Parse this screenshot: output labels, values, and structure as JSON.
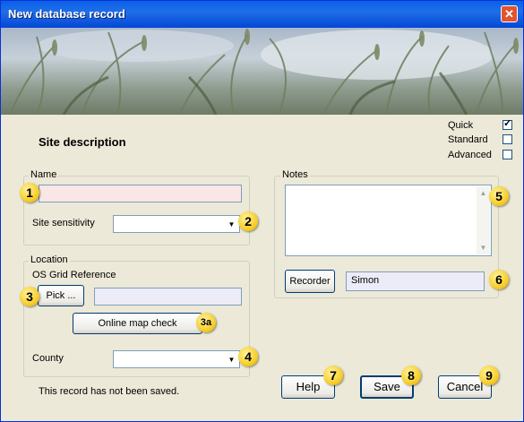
{
  "window": {
    "title": "New database record",
    "close_glyph": "✕"
  },
  "section_title": "Site description",
  "modes": [
    {
      "label": "Quick",
      "checked": true
    },
    {
      "label": "Standard",
      "checked": false
    },
    {
      "label": "Advanced",
      "checked": false
    }
  ],
  "name_group": {
    "legend": "Name",
    "name_value": "",
    "sensitivity_label": "Site sensitivity",
    "sensitivity_value": ""
  },
  "location_group": {
    "legend": "Location",
    "grid_ref_label": "OS Grid Reference",
    "pick_label": "Pick ...",
    "grid_ref_value": "",
    "map_check_label": "Online map check",
    "county_label": "County",
    "county_value": ""
  },
  "notes_group": {
    "legend": "Notes",
    "notes_value": "",
    "recorder_label": "Recorder",
    "recorder_value": "Simon"
  },
  "status_text": "This record has not been saved.",
  "buttons": {
    "help": "Help",
    "save": "Save",
    "cancel": "Cancel"
  },
  "badges": [
    "1",
    "2",
    "3",
    "3a",
    "4",
    "5",
    "6",
    "7",
    "8",
    "9"
  ],
  "colors": {
    "dialog_bg": "#ece9d8",
    "titlebar": "#0a5fe8",
    "badge": "#f7cf2a",
    "required_field": "#fbe6e6",
    "optional_field": "#ececf8"
  },
  "icons": {
    "close": "close-icon",
    "dropdown": "chevron-down-icon",
    "scroll_up": "arrow-up-icon",
    "scroll_down": "arrow-down-icon"
  }
}
